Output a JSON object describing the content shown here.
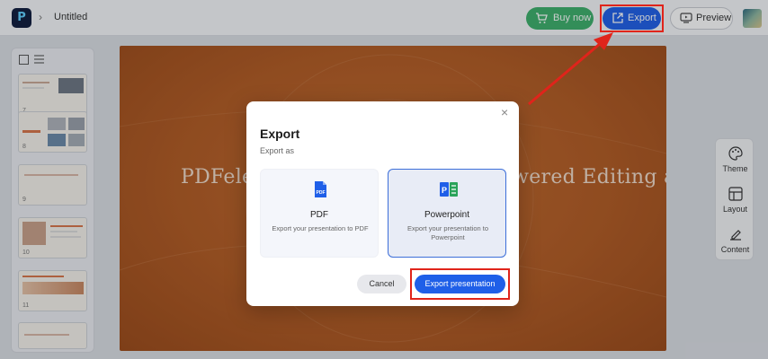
{
  "app": {
    "doc_title": "Untitled"
  },
  "toolbar": {
    "buy_label": "Buy now",
    "export_label": "Export",
    "preview_label": "Preview"
  },
  "thumbnails": [
    {
      "num": "7"
    },
    {
      "num": "8"
    },
    {
      "num": "9"
    },
    {
      "num": "10"
    },
    {
      "num": "11"
    },
    {
      "num": ""
    }
  ],
  "slide": {
    "title": "PDFelement Presentation: AI-Powered Editing and"
  },
  "right_rail": {
    "theme_label": "Theme",
    "layout_label": "Layout",
    "content_label": "Content"
  },
  "modal": {
    "title": "Export",
    "subtitle": "Export as",
    "close_glyph": "×",
    "options": [
      {
        "name": "PDF",
        "description": "Export your presentation to PDF",
        "selected": false
      },
      {
        "name": "Powerpoint",
        "description": "Export your presentation to Powerpoint",
        "selected": true
      }
    ],
    "cancel_label": "Cancel",
    "export_label": "Export presentation"
  },
  "colors": {
    "accent": "#1f5fe8",
    "buy": "#3db06b",
    "highlight": "#e0241b",
    "slide_bg": "#b35b22"
  }
}
